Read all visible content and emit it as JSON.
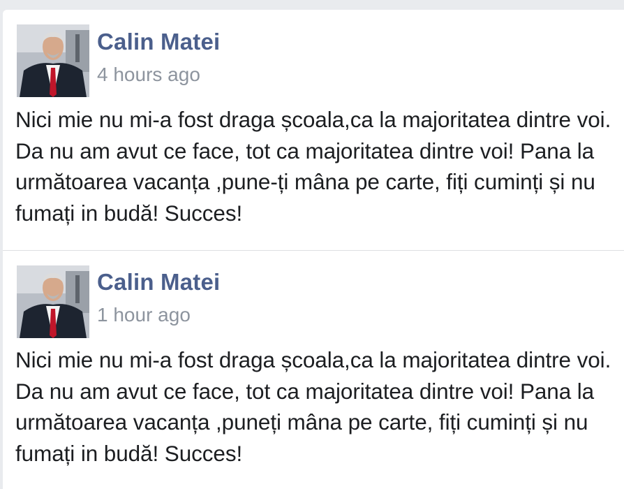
{
  "posts": [
    {
      "author": "Calin Matei",
      "time": "4 hours ago",
      "text": "Nici mie nu mi-a fost draga școala,ca la majoritatea dintre voi. Da nu am avut ce face, tot ca majoritatea dintre voi! Pana la următoarea vacanța ,pune-ți mâna pe carte, fiți cuminți și nu fumați in budă! Succes!",
      "avatar_icon": "profile-photo-icon"
    },
    {
      "author": "Calin Matei",
      "time": "1 hour ago",
      "text": "Nici mie nu mi-a fost draga școala,ca la majoritatea dintre voi. Da nu am avut ce face, tot ca majoritatea dintre voi! Pana la următoarea vacanța ,puneți mâna pe carte, fiți cuminți și nu fumați in budă! Succes!",
      "avatar_icon": "profile-photo-icon"
    }
  ],
  "colors": {
    "author_name": "#4b5f8c",
    "timestamp": "#8d949e",
    "body_text": "#1c1e21",
    "background": "#e9ebee"
  }
}
